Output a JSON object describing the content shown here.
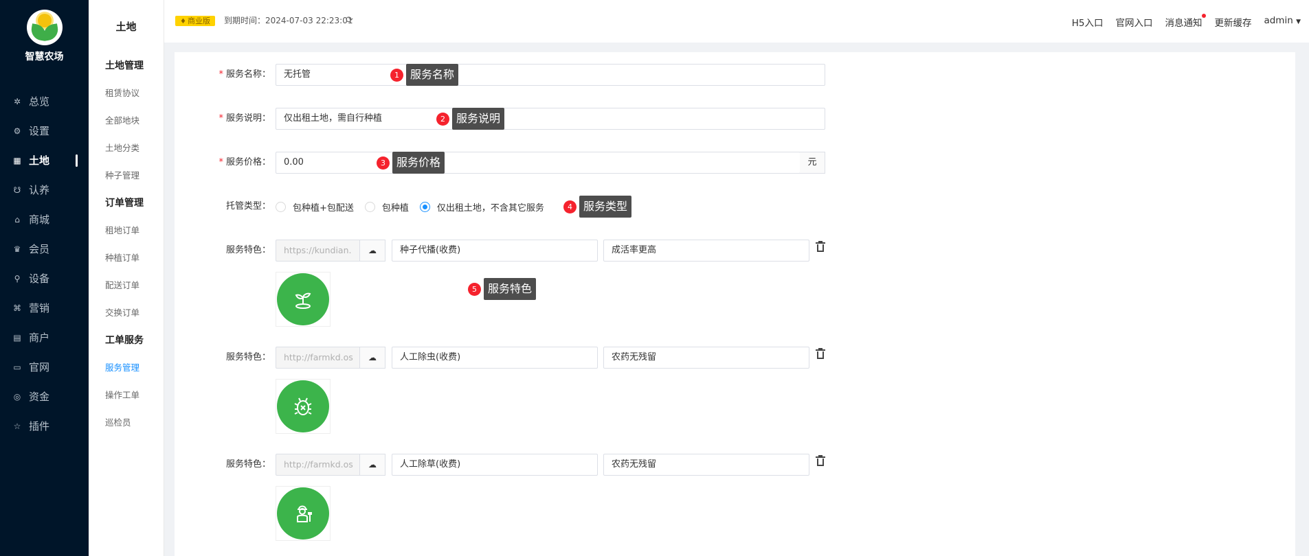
{
  "brand": {
    "name": "智慧农场"
  },
  "nav": [
    {
      "icon": "dashboard-icon",
      "label": "总览"
    },
    {
      "icon": "settings-icon",
      "label": "设置"
    },
    {
      "icon": "land-icon",
      "label": "土地",
      "active": true
    },
    {
      "icon": "adopt-icon",
      "label": "认养"
    },
    {
      "icon": "mall-icon",
      "label": "商城"
    },
    {
      "icon": "member-icon",
      "label": "会员"
    },
    {
      "icon": "device-icon",
      "label": "设备"
    },
    {
      "icon": "marketing-icon",
      "label": "营销"
    },
    {
      "icon": "merchant-icon",
      "label": "商户"
    },
    {
      "icon": "website-icon",
      "label": "官网"
    },
    {
      "icon": "funds-icon",
      "label": "资金"
    },
    {
      "icon": "plugin-icon",
      "label": "插件"
    }
  ],
  "submenu": {
    "title": "土地",
    "groups": [
      {
        "label": "土地管理",
        "items": [
          "租赁协议",
          "全部地块",
          "土地分类",
          "种子管理"
        ]
      },
      {
        "label": "订单管理",
        "items": [
          "租地订单",
          "种植订单",
          "配送订单",
          "交换订单"
        ]
      },
      {
        "label": "工单服务",
        "items": [
          "服务管理",
          "操作工单",
          "巡检员"
        ]
      }
    ],
    "active_item": "服务管理"
  },
  "topbar": {
    "edition": "商业版",
    "expire_label": "到期时间：",
    "expire_time": "2024-07-03 22:23:01",
    "links": [
      "H5入口",
      "官网入口",
      "消息通知",
      "更新缓存",
      "admin"
    ]
  },
  "form": {
    "name": {
      "label": "服务名称：",
      "value": "无托管"
    },
    "desc": {
      "label": "服务说明：",
      "value": "仅出租土地，需自行种植"
    },
    "price": {
      "label": "服务价格：",
      "value": "0.00",
      "unit": "元"
    },
    "type": {
      "label": "托管类型：",
      "options": [
        "包种植+包配送",
        "包种植",
        "仅出租土地，不含其它服务"
      ],
      "selected": "仅出租土地，不含其它服务"
    },
    "feature_label": "服务特色：",
    "features": [
      {
        "url": "https://kundian.",
        "name": "种子代播(收费)",
        "desc": "成活率更高",
        "icon": "seedling-icon"
      },
      {
        "url": "http://farmkd.os",
        "name": "人工除虫(收费)",
        "desc": "农药无残留",
        "icon": "bug-free-icon"
      },
      {
        "url": "http://farmkd.os",
        "name": "人工除草(收费)",
        "desc": "农药无残留",
        "icon": "farmer-icon"
      }
    ]
  },
  "annotations": [
    {
      "num": "1",
      "text": "服务名称"
    },
    {
      "num": "2",
      "text": "服务说明"
    },
    {
      "num": "3",
      "text": "服务价格"
    },
    {
      "num": "4",
      "text": "服务类型"
    },
    {
      "num": "5",
      "text": "服务特色"
    }
  ]
}
